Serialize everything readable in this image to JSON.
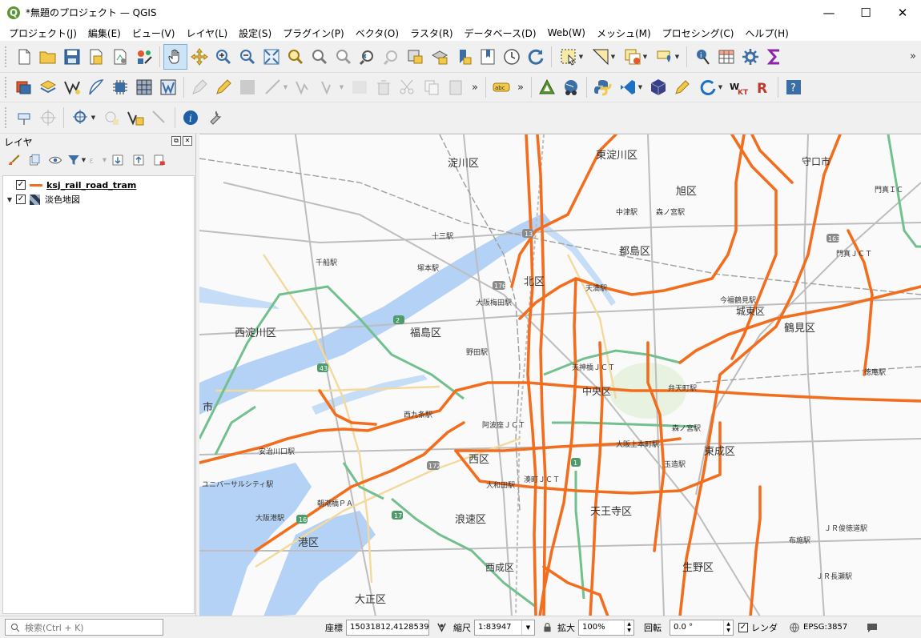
{
  "window": {
    "title": "*無題のプロジェクト — QGIS",
    "logo": "Q",
    "controls": {
      "minimize": "—",
      "maximize": "☐",
      "close": "✕"
    }
  },
  "menu": [
    {
      "id": "project",
      "label": "プロジェクト(J)"
    },
    {
      "id": "edit",
      "label": "編集(E)"
    },
    {
      "id": "view",
      "label": "ビュー(V)"
    },
    {
      "id": "layer",
      "label": "レイヤ(L)"
    },
    {
      "id": "settings",
      "label": "設定(S)"
    },
    {
      "id": "plugins",
      "label": "プラグイン(P)"
    },
    {
      "id": "vector",
      "label": "ベクタ(O)"
    },
    {
      "id": "raster",
      "label": "ラスタ(R)"
    },
    {
      "id": "database",
      "label": "データベース(D)"
    },
    {
      "id": "web",
      "label": "Web(W)"
    },
    {
      "id": "mesh",
      "label": "メッシュ(M)"
    },
    {
      "id": "processing",
      "label": "プロセシング(C)"
    },
    {
      "id": "help",
      "label": "ヘルプ(H)"
    }
  ],
  "toolbars": {
    "overflow": "»",
    "label_tool": "abc"
  },
  "layers_panel": {
    "title": "レイヤ",
    "layers": [
      {
        "name": "ksj_rail_road_tram",
        "checked": "✓",
        "symbol": "line",
        "color": "#f26e1e"
      },
      {
        "name": "淡色地図",
        "checked": "✓",
        "symbol": "raster",
        "expand": "▼"
      }
    ]
  },
  "map": {
    "route_color": "#f26e1e",
    "water_color": "#b4d2f5",
    "labels": [
      "淀川区",
      "東淀川区",
      "旭区",
      "守口市",
      "都島区",
      "北区",
      "福島区",
      "西淀川区",
      "城東区",
      "鶴見区",
      "中央区",
      "東成区",
      "西区",
      "浪速区",
      "天王寺区",
      "港区",
      "大正区",
      "西成区",
      "生野区",
      "市",
      "十三駅",
      "塚本駅",
      "千船駅",
      "大阪梅田駅",
      "天満駅",
      "大阪城公園駅",
      "森ノ宮駅",
      "弁天町駅",
      "西九条駅",
      "野田駅",
      "安治川口駅",
      "ユニバーサルシティ駅",
      "朝潮橋ＰＡ",
      "朝潮橋駅",
      "大阪港駅",
      "今福鶴見駅",
      "玉造駅",
      "大阪上本町駅",
      "ＪＲ俊徳道駅",
      "徳庵駅",
      "放出駅",
      "門真ＪＣＴ",
      "門真ＩＣ",
      "阿波座ＪＣＴ",
      "天神橋ＪＣＴ",
      "大阪城北詰",
      "布施駅",
      "鶴橋駅",
      "大阪難波駅",
      "近鉄大阪線",
      "東大阪線",
      "おおさか東線",
      "守口線",
      "法円坂",
      "湊町ＪＣＴ",
      "ＪＲ長瀬駅",
      "南巽駅",
      "芦原橋駅",
      "大和田駅",
      "森小路駅",
      "京橋駅",
      "中津駅",
      "桜ノ宮駅",
      "ＪＲ野江駅",
      "高殿",
      "城北公園通駅",
      "淡路駅",
      "大阪城駅",
      "天満橋駅",
      "阪神高速",
      "大阪環状線"
    ],
    "shields": [
      "2",
      "16",
      "17",
      "43",
      "172",
      "176",
      "1",
      "163",
      "13"
    ]
  },
  "statusbar": {
    "search_placeholder": "検索(Ctrl + K)",
    "coordinate_label": "座標",
    "coordinate_value": "15031812,4128539",
    "scale_label": "縮尺",
    "scale_value": "1:83947",
    "magnifier_label": "拡大",
    "magnifier_value": "100%",
    "rotation_label": "回転",
    "rotation_value": "0.0 °",
    "render_label": "レンダ",
    "render_checked": "✓",
    "crs": "EPSG:3857"
  }
}
